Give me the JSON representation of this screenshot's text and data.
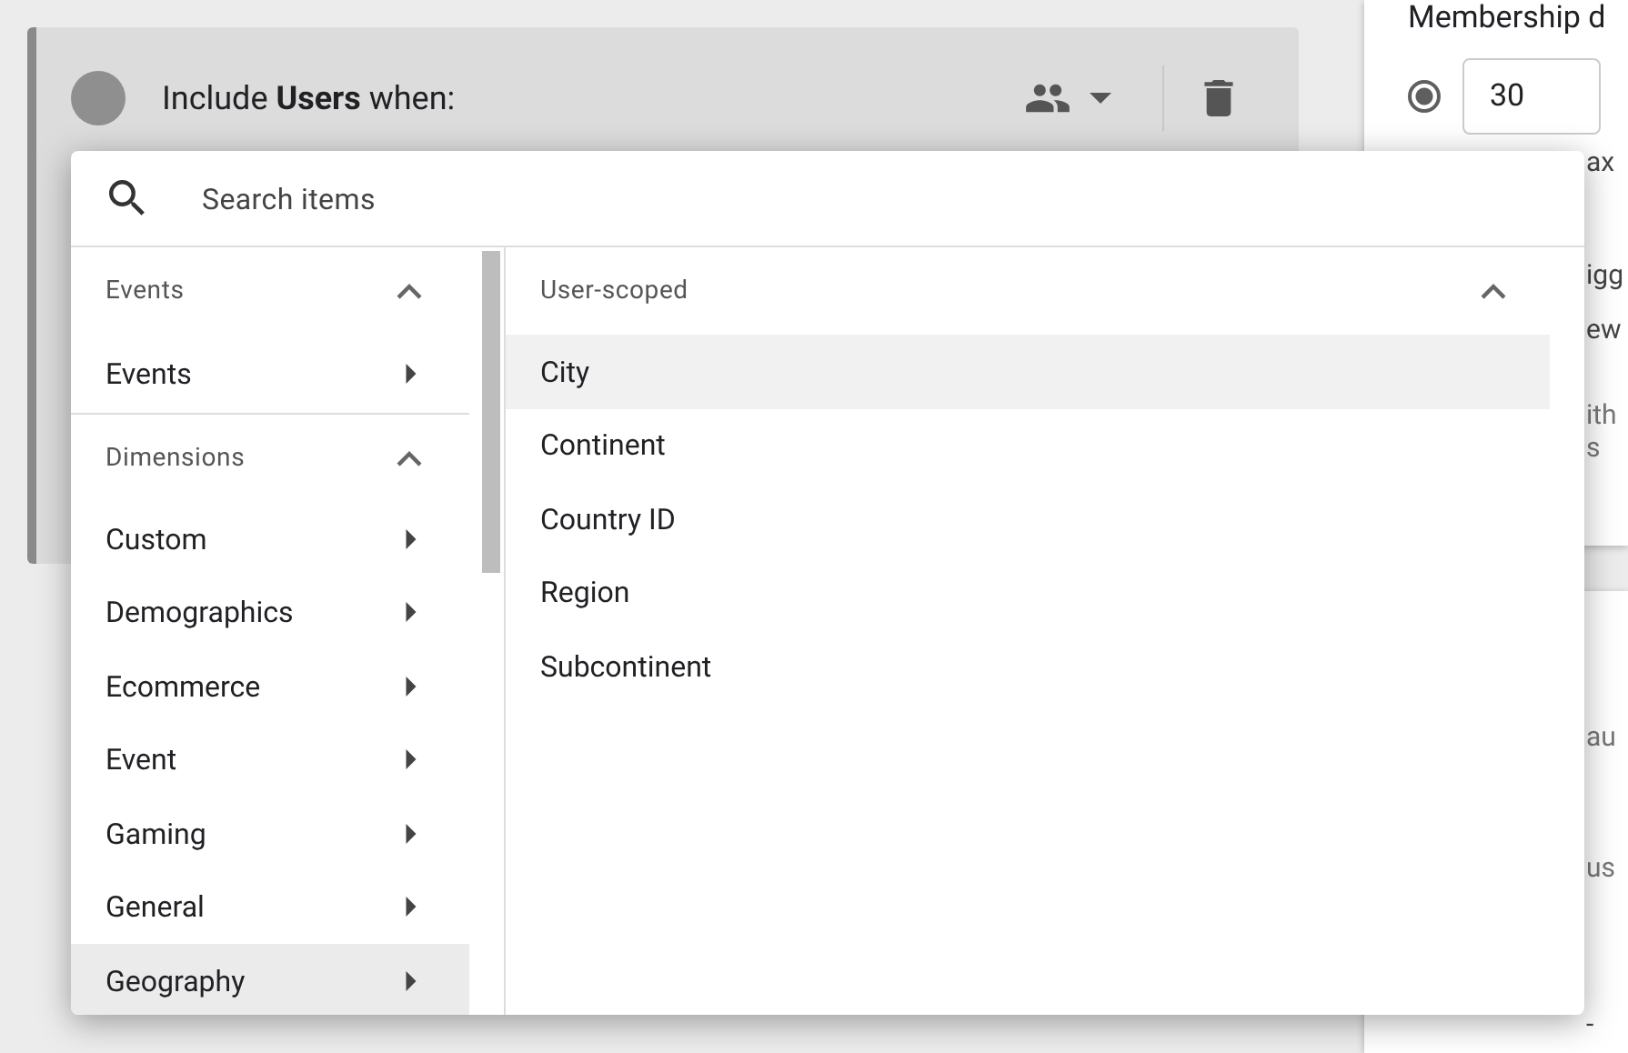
{
  "condition_card": {
    "title": "Include **Users** when:"
  },
  "side_panel": {
    "heading": "Membership d",
    "duration": {
      "selected": true,
      "value": "30"
    },
    "option_2": {
      "label": "ax"
    },
    "texts": [
      "igg",
      "ew",
      "ith",
      "s"
    ]
  },
  "lower_panel": {
    "texts": [
      "au",
      "us",
      "-"
    ]
  },
  "picker": {
    "search": {
      "placeholder": "Search items"
    },
    "sections": [
      {
        "title": "Events",
        "expanded": true,
        "items": [
          {
            "label": "Events",
            "selected": false
          }
        ]
      },
      {
        "title": "Dimensions",
        "expanded": true,
        "items": [
          {
            "label": "Custom",
            "selected": false
          },
          {
            "label": "Demographics",
            "selected": false
          },
          {
            "label": "Ecommerce",
            "selected": false
          },
          {
            "label": "Event",
            "selected": false
          },
          {
            "label": "Gaming",
            "selected": false
          },
          {
            "label": "General",
            "selected": false
          },
          {
            "label": "Geography",
            "selected": true
          }
        ]
      }
    ],
    "subpanel": {
      "title": "User-scoped",
      "expanded": true,
      "items": [
        {
          "label": "City",
          "selected": true
        },
        {
          "label": "Continent",
          "selected": false
        },
        {
          "label": "Country ID",
          "selected": false
        },
        {
          "label": "Region",
          "selected": false
        },
        {
          "label": "Subcontinent",
          "selected": false
        }
      ]
    }
  }
}
